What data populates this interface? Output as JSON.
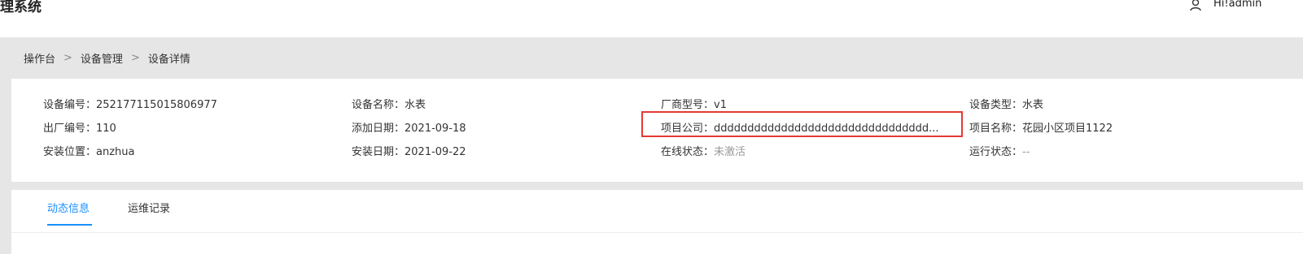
{
  "header": {
    "app_title": "理系统",
    "user_label": "Hi!admin"
  },
  "breadcrumb": [
    "操作台",
    "设备管理",
    "设备详情"
  ],
  "breadcrumb_separator": ">",
  "details": {
    "device_no_label": "设备编号：",
    "device_no": "252177115015806977",
    "device_name_label": "设备名称：",
    "device_name": "水表",
    "model_label": "厂商型号：",
    "model": "v1",
    "device_type_label": "设备类型：",
    "device_type": "水表",
    "factory_no_label": "出厂编号：",
    "factory_no": "110",
    "added_date_label": "添加日期：",
    "added_date": "2021-09-18",
    "company_label": "项目公司：",
    "company": "dddddddddddddddddddddddddddddddd...",
    "project_name_label": "项目名称：",
    "project_name": "花园小区项目1122",
    "location_label": "安装位置：",
    "location": "anzhua",
    "install_date_label": "安装日期：",
    "install_date": "2021-09-22",
    "online_status_label": "在线状态：",
    "online_status": "未激活",
    "run_status_label": "运行状态：",
    "run_status": "--"
  },
  "tabs": [
    "动态信息",
    "运维记录"
  ],
  "colors": {
    "accent": "#1890ff",
    "highlight_border": "#e53935",
    "muted_text": "#999999"
  },
  "icons": {
    "user": "user-icon"
  }
}
